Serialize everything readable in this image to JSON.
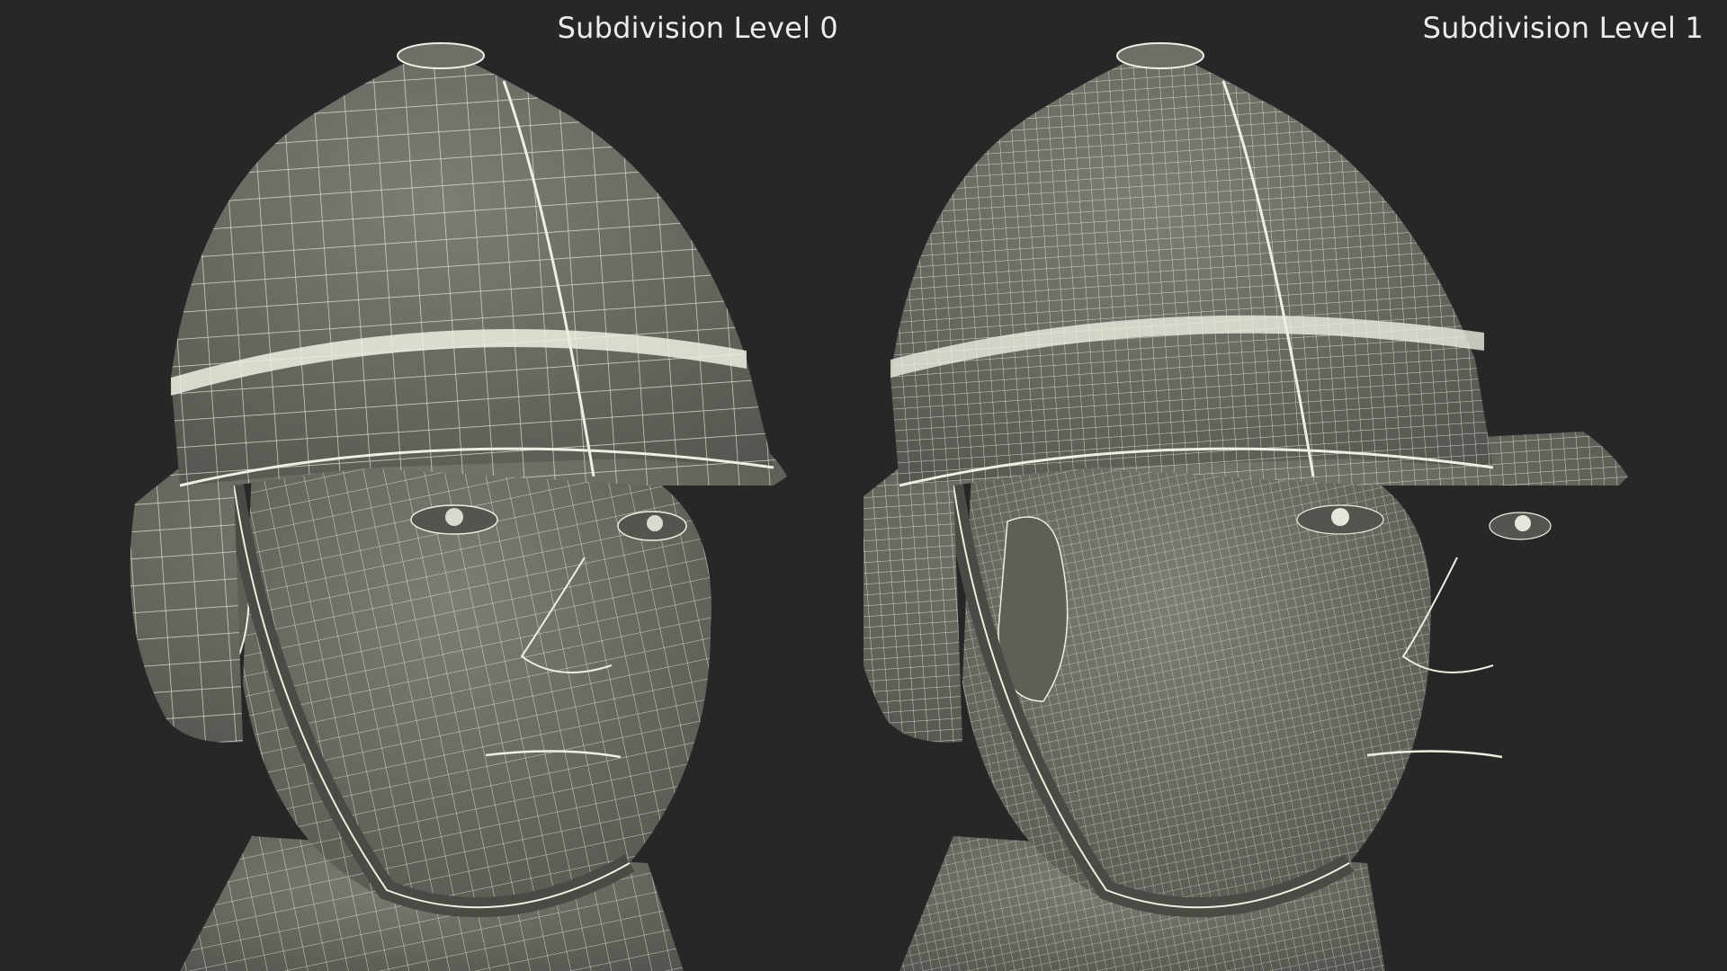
{
  "scene": {
    "background": "#262727",
    "mesh_surface_color": "#6f6f67",
    "wire_color": "#eeeee2"
  },
  "panels": [
    {
      "label": "Subdivision Level 0",
      "subject": "wireframe head with pith helmet",
      "wire_density": "low"
    },
    {
      "label": "Subdivision Level 1",
      "subject": "wireframe head with pith helmet",
      "wire_density": "high"
    }
  ]
}
